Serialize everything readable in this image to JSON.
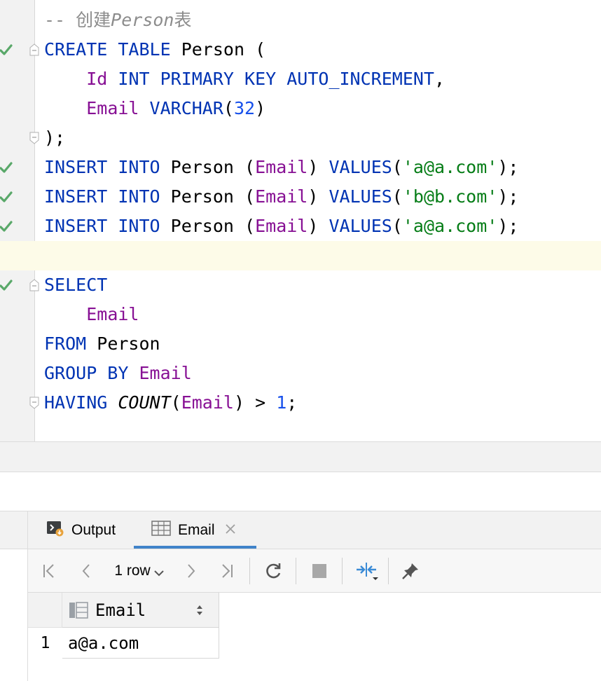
{
  "editor": {
    "comment": {
      "dashes": "-- ",
      "prefix": "创建",
      "name": "Person",
      "suffix": "表"
    },
    "create_table": {
      "kw_create": "CREATE",
      "kw_table": "TABLE",
      "table": "Person",
      "open": " (",
      "col1": "Id",
      "col1_type": "INT",
      "col1_pk": "PRIMARY KEY",
      "col1_ai": "AUTO_INCREMENT",
      "col1_comma": ",",
      "col2": "Email",
      "col2_type": "VARCHAR",
      "col2_open": "(",
      "col2_len": "32",
      "col2_close": ")",
      "close": ");"
    },
    "inserts": [
      {
        "value": "'a@a.com'"
      },
      {
        "value": "'b@b.com'"
      },
      {
        "value": "'a@a.com'"
      }
    ],
    "insert_tokens": {
      "kw_insert": "INSERT",
      "kw_into": "INTO",
      "table": "Person",
      "lparen": "(",
      "col": "Email",
      "rparen": ")",
      "kw_values": "VALUES",
      "vopen": "(",
      "vclose": ");"
    },
    "select": {
      "kw_select": "SELECT",
      "col": "Email",
      "kw_from": "FROM",
      "table": "Person",
      "kw_group_by": "GROUP BY",
      "group_col": "Email",
      "kw_having": "HAVING",
      "fn": "COUNT",
      "fn_open": "(",
      "fn_col": "Email",
      "fn_close": ")",
      "op": ">",
      "num": "1",
      "end": ";"
    }
  },
  "services": {
    "tabs": [
      {
        "label": "Output",
        "icon": "console-output-icon"
      },
      {
        "label": "Email",
        "icon": "table-grid-icon",
        "active": true
      }
    ],
    "toolbar": {
      "row_count": "1 row"
    },
    "grid": {
      "columns": [
        {
          "label": "Email",
          "icon": "column-icon"
        }
      ],
      "rows": [
        {
          "num": "1",
          "cells": [
            "a@a.com"
          ]
        }
      ]
    }
  },
  "colors": {
    "keyword": "#0033b3",
    "column": "#871094",
    "string": "#067d17",
    "number": "#1750eb",
    "comment": "#8c8c8c",
    "check": "#59a869",
    "accent": "#4083c9"
  }
}
